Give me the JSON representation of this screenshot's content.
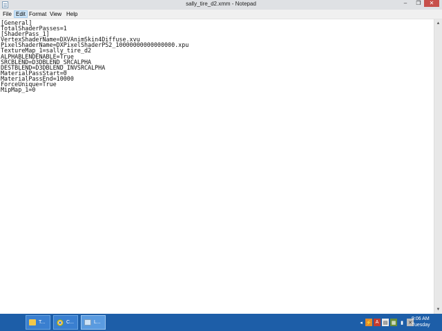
{
  "window": {
    "title": "sally_tire_d2.xmm - Notepad",
    "minimize_glyph": "‒",
    "maximize_glyph": "❐",
    "close_glyph": "✕"
  },
  "menu": [
    "File",
    "Edit",
    "Format",
    "View",
    "Help"
  ],
  "menu_active": "Edit",
  "document": {
    "content": "[General]\nTotalShaderPasses=1\n[ShaderPass_1]\nVertexShaderName=DXVAnimSkin4Diffuse.xvu\nPixelShaderName=DXPixelShaderPS2_10000000000000000.xpu\nTextureMap_1=sally_tire_d2\nALPHABLENDENABLE=True\nSRCBLEND=D3DBLEND_SRCALPHA\nDESTBLEND=D3DBLEND_INVSRCALPHA\nMaterialPassStart=0\nMaterialPassEnd=10000\nForceUnique=True\nMipMap_1=0"
  },
  "scrollbar": {
    "up_glyph": "▲",
    "down_glyph": "▼"
  },
  "taskbar": {
    "buttons": [
      {
        "label": "T...",
        "icon": "folder-icon"
      },
      {
        "label": "C...",
        "icon": "chrome-icon"
      },
      {
        "label": "L...",
        "icon": "notepad-icon",
        "active": true
      }
    ],
    "tray_glyphs": [
      "◂",
      "⚡",
      "A",
      "▤",
      "▦",
      "▮",
      "✕"
    ],
    "clock": {
      "time": "9:06 AM",
      "day": "Tuesday"
    }
  },
  "colors": {
    "taskbar": "#1d5ea8",
    "titlebar": "#dfe1e4",
    "close_button": "#c7504b",
    "menu_highlight": "#cce4f7"
  }
}
